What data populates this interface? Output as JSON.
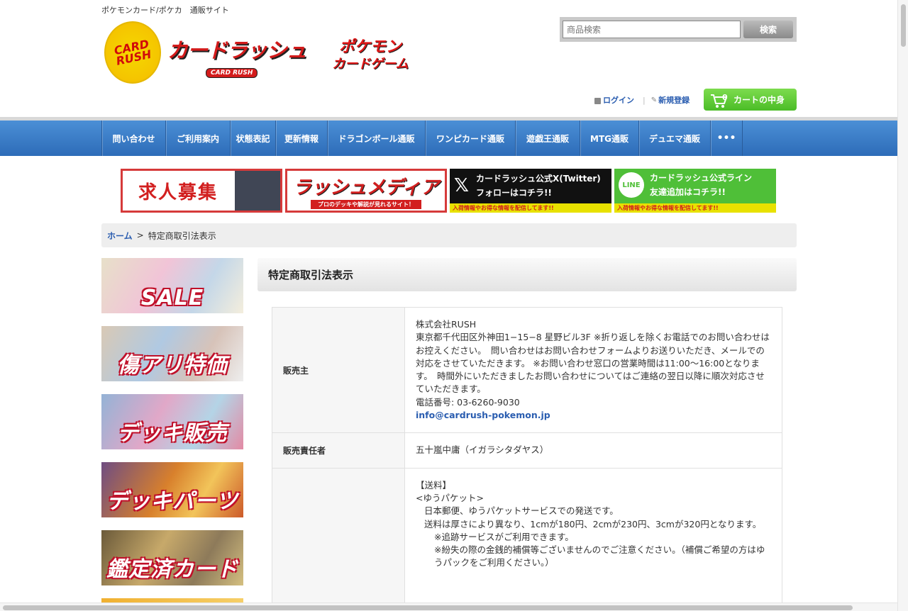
{
  "header": {
    "tagline": "ポケモンカード/ポケカ　通販サイト",
    "logo_circle_text": "CARD RUSH",
    "logo_main": "カードラッシュ",
    "logo_sub": "CARD RUSH",
    "logo_poke_1": "ポケモン",
    "logo_poke_2": "カードゲーム"
  },
  "search": {
    "placeholder": "商品検索",
    "button": "検索"
  },
  "user": {
    "login": "ログイン",
    "register": "新規登録",
    "cart_label": "カートの中身",
    "cart_count": "0"
  },
  "nav": {
    "items": [
      "問い合わせ",
      "ご利用案内",
      "状態表記",
      "更新情報",
      "ドラゴンボール通販",
      "ワンピカード通販",
      "遊戯王通販",
      "MTG通販",
      "デュエマ通販",
      "•••"
    ]
  },
  "banners": {
    "recruit": "求人募集",
    "media_title": "ラッシュメディア",
    "media_sub": "プロのデッキや解説が見れるサイト！",
    "x_line1": "カードラッシュ公式X(Twitter)",
    "x_line2": "フォローはコチラ!!",
    "x_foot": "入荷情報やお得な情報を配信してます!!",
    "line_icon": "LINE",
    "line_line1": "カードラッシュ公式ライン",
    "line_line2": "友達追加はコチラ!!",
    "line_foot": "入荷情報やお得な情報を配信してます!!"
  },
  "breadcrumb": {
    "home": "ホーム",
    "separator": ">",
    "current": "特定商取引法表示"
  },
  "side_banners": [
    "SALE",
    "傷アリ特価",
    "デッキ販売",
    "デッキパーツ",
    "鑑定済カード"
  ],
  "main": {
    "title": "特定商取引法表示",
    "rows": [
      {
        "label": "販売主",
        "company": "株式会社RUSH",
        "address": "東京都千代田区外神田1−15−8 星野ビル3F ※折り返しを除くお電話でのお問い合わせはお控えください。　問い合わせはお問い合わせフォームよりお送りいただき、メールでの対応をさせていただきます。 ※お問い合わせ窓口の営業時間は11:00〜16:00となります。　時間外にいただきましたお問い合わせについてはご連絡の翌日以降に順次対応させていただきます。",
        "phone": "電話番号: 03-6260-9030",
        "email": "info@cardrush-pokemon.jp"
      },
      {
        "label": "販売責任者",
        "value": "五十嵐中庸（イガラシタダヤス）"
      },
      {
        "label": "",
        "shipping_title": "【送料】",
        "yupacket": "<ゆうパケット>",
        "line1": "日本郵便、ゆうパケットサービスでの発送です。",
        "line2": "送料は厚さにより異なり、1cmが180円、2cmが230円、3cmが320円となります。",
        "line3": "※追跡サービスがご利用できます。",
        "line4": "※紛失の際の金銭的補償等ございませんのでご注意ください。（補償ご希望の方はゆうパックをご利用ください。）"
      }
    ]
  },
  "colors": {
    "nav_blue": "#2d6cb8",
    "link_blue": "#2a5db0",
    "cart_green": "#4bbd27",
    "brand_red": "#d21f1f"
  }
}
